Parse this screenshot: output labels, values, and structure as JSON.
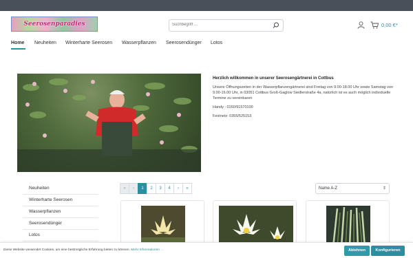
{
  "header": {
    "logo_text": "Seerosenparadies",
    "search_placeholder": "Suchbegriff ...",
    "cart_amount": "0,00 €*"
  },
  "nav": {
    "items": [
      "Home",
      "Neuheiten",
      "Winterharte Seerosen",
      "Wasserpflanzen",
      "Seerosendünger",
      "Lotos"
    ]
  },
  "welcome": {
    "title": "Herzlich willkommen in unserer Seerosengärtnerei in Cottbus",
    "text": "Unsere Öffnungszeiten in der Wasserpflanzengärtnerei sind Freitag von 9.00-18.00 Uhr sowie Samstag von 9.00-16.00 Uhr, in 03051 Cottbus Groß-Gaglow Siedlerstraße 4a,  natürlich ist es  auch möglich individuelle Termine zu vereinbaren",
    "phone": "Handy : 0160/91570100",
    "fax": "Festnetz: 0355/525153"
  },
  "sidebar": {
    "items": [
      "Neuheiten",
      "Winterharte Seerosen",
      "Wasserpflanzen",
      "Seerosendünger",
      "Lotos"
    ]
  },
  "pagination": {
    "first": "«",
    "prev": "‹",
    "pages": [
      "1",
      "2",
      "3",
      "4"
    ],
    "current": "1",
    "next": "›",
    "last": "»"
  },
  "sort": {
    "selected": "Name A-Z"
  },
  "cookie": {
    "text": "Diese Website verwendet Cookies, um eine bestmögliche Erfahrung bieten zu können.",
    "more_link": "Mehr Informationen ...",
    "decline": "Ablehnen",
    "configure": "Konfigurieren"
  },
  "colors": {
    "accent": "#2b8fa0",
    "topbar": "#4a5059"
  }
}
